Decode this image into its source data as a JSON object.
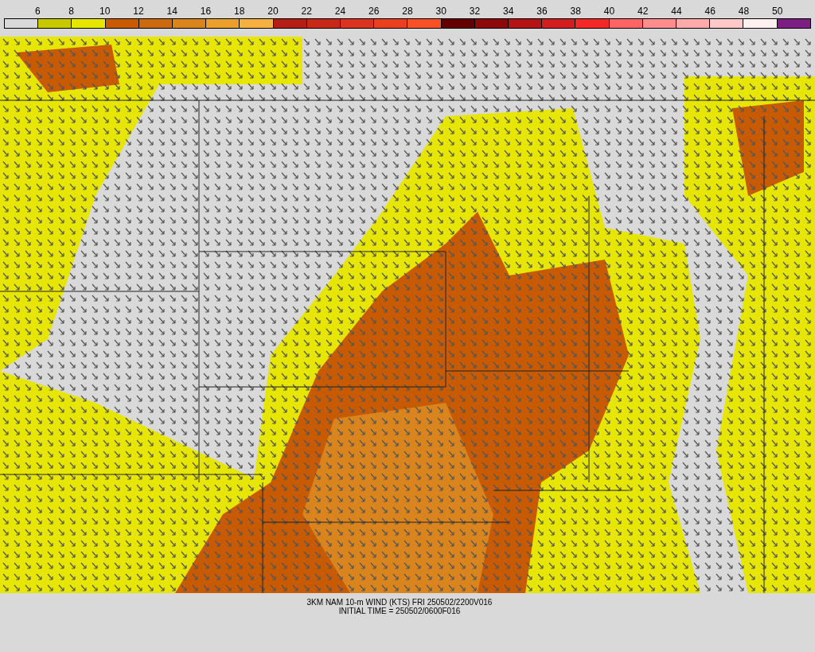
{
  "legend": {
    "labels": [
      "6",
      "8",
      "10",
      "12",
      "14",
      "16",
      "18",
      "20",
      "22",
      "24",
      "26",
      "28",
      "30",
      "32",
      "34",
      "36",
      "38",
      "40",
      "42",
      "44",
      "46",
      "48",
      "50"
    ],
    "swatches": [
      {
        "color": "#d9d9d9"
      },
      {
        "color": "#c8c800"
      },
      {
        "color": "#e6e600"
      },
      {
        "color": "#c85a00"
      },
      {
        "color": "#cd6a10"
      },
      {
        "color": "#d9841c"
      },
      {
        "color": "#eba02c"
      },
      {
        "color": "#f5b040"
      },
      {
        "color": "#b41e14"
      },
      {
        "color": "#c82818"
      },
      {
        "color": "#dc3220"
      },
      {
        "color": "#eb4020"
      },
      {
        "color": "#fa5028"
      },
      {
        "color": "#640000"
      },
      {
        "color": "#8c0a0a"
      },
      {
        "color": "#b41414"
      },
      {
        "color": "#d21e1e"
      },
      {
        "color": "#f52828"
      },
      {
        "color": "#ff6464"
      },
      {
        "color": "#ff8c8c"
      },
      {
        "color": "#ffaaaa"
      },
      {
        "color": "#ffc8c8"
      },
      {
        "color": "#fff0f0"
      },
      {
        "color": "#7d1e82"
      }
    ]
  },
  "caption": {
    "title": "3KM NAM 10-m WIND (KTS) FRI 250502/2200V016",
    "initial_time": "INITIAL TIME = 250502/0600F016"
  }
}
